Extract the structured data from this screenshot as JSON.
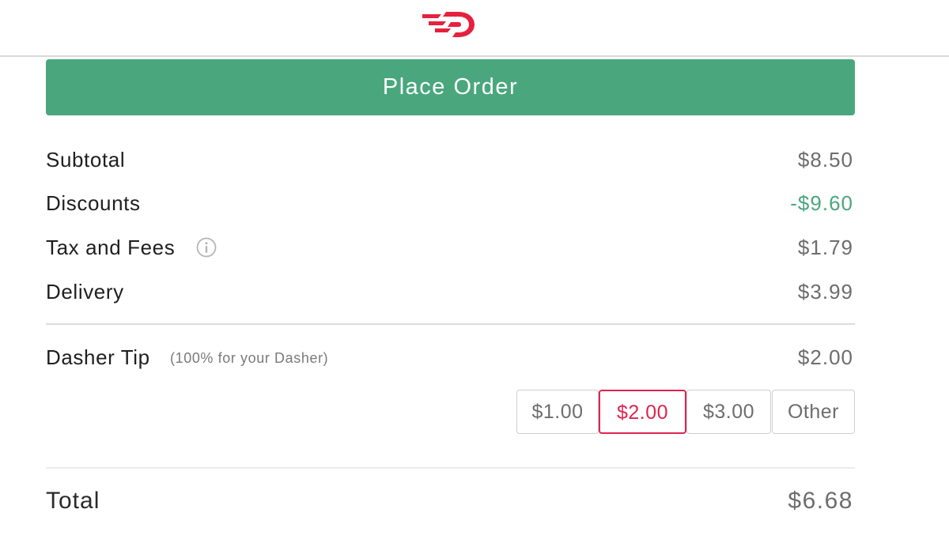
{
  "header": {
    "logo_icon": "doordash-logo-icon",
    "brand_color": "#e5213d"
  },
  "place_order": {
    "label": "Place Order",
    "color": "#4aa77d"
  },
  "summary": {
    "subtotal": {
      "label": "Subtotal",
      "value": "$8.50"
    },
    "discounts": {
      "label": "Discounts",
      "value": "-$9.60",
      "color": "#4aa77d"
    },
    "tax_fees": {
      "label": "Tax and Fees",
      "value": "$1.79",
      "icon": "info-icon"
    },
    "delivery": {
      "label": "Delivery",
      "value": "$3.99"
    }
  },
  "tip": {
    "label": "Dasher Tip",
    "note": "(100% for your Dasher)",
    "value": "$2.00",
    "options": [
      "$1.00",
      "$2.00",
      "$3.00",
      "Other"
    ],
    "selected": "$2.00",
    "selected_color": "#e0234f"
  },
  "total": {
    "label": "Total",
    "value": "$6.68"
  }
}
